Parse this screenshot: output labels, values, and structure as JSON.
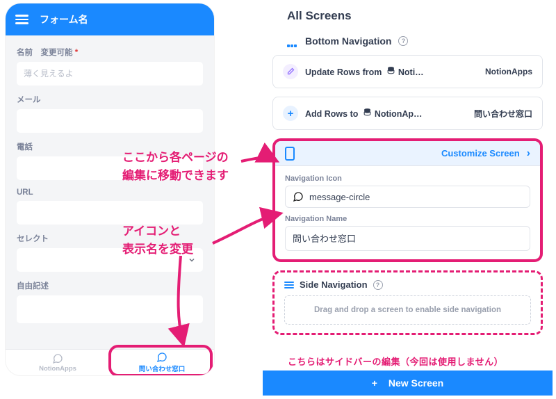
{
  "mobile": {
    "title": "フォーム名",
    "fields": {
      "name": {
        "label": "名前　変更可能",
        "required": "*",
        "placeholder": "薄く見えるよ"
      },
      "mail": {
        "label": "メール"
      },
      "phone": {
        "label": "電話"
      },
      "url": {
        "label": "URL"
      },
      "select": {
        "label": "セレクト"
      },
      "freetext": {
        "label": "自由記述"
      }
    },
    "bottom_nav": {
      "tab_a": "NotionApps",
      "tab_b": "問い合わせ窓口"
    }
  },
  "right": {
    "all_screens_title": "All Screens",
    "bottom_nav_title": "Bottom Navigation",
    "cards": {
      "update_rows": {
        "prefix": "Update Rows from",
        "db": "Noti…",
        "right": "NotionApps"
      },
      "add_rows": {
        "prefix": "Add Rows to",
        "db": "NotionAp…",
        "right": "問い合わせ窓口"
      }
    },
    "customize_label": "Customize Screen",
    "nav_icon": {
      "label": "Navigation Icon",
      "value": "message-circle"
    },
    "nav_name": {
      "label": "Navigation Name",
      "value": "問い合わせ窓口"
    },
    "side_nav_title": "Side Navigation",
    "dropzone_text": "Drag and drop a screen to enable side navigation",
    "new_screen_label": "New Screen"
  },
  "annotations": {
    "a1_line1": "ここから各ページの",
    "a1_line2": "編集に移動できます",
    "a2_line1": "アイコンと",
    "a2_line2": "表示名を変更",
    "side_annot": "こちらはサイドバーの編集（今回は使用しません）"
  }
}
